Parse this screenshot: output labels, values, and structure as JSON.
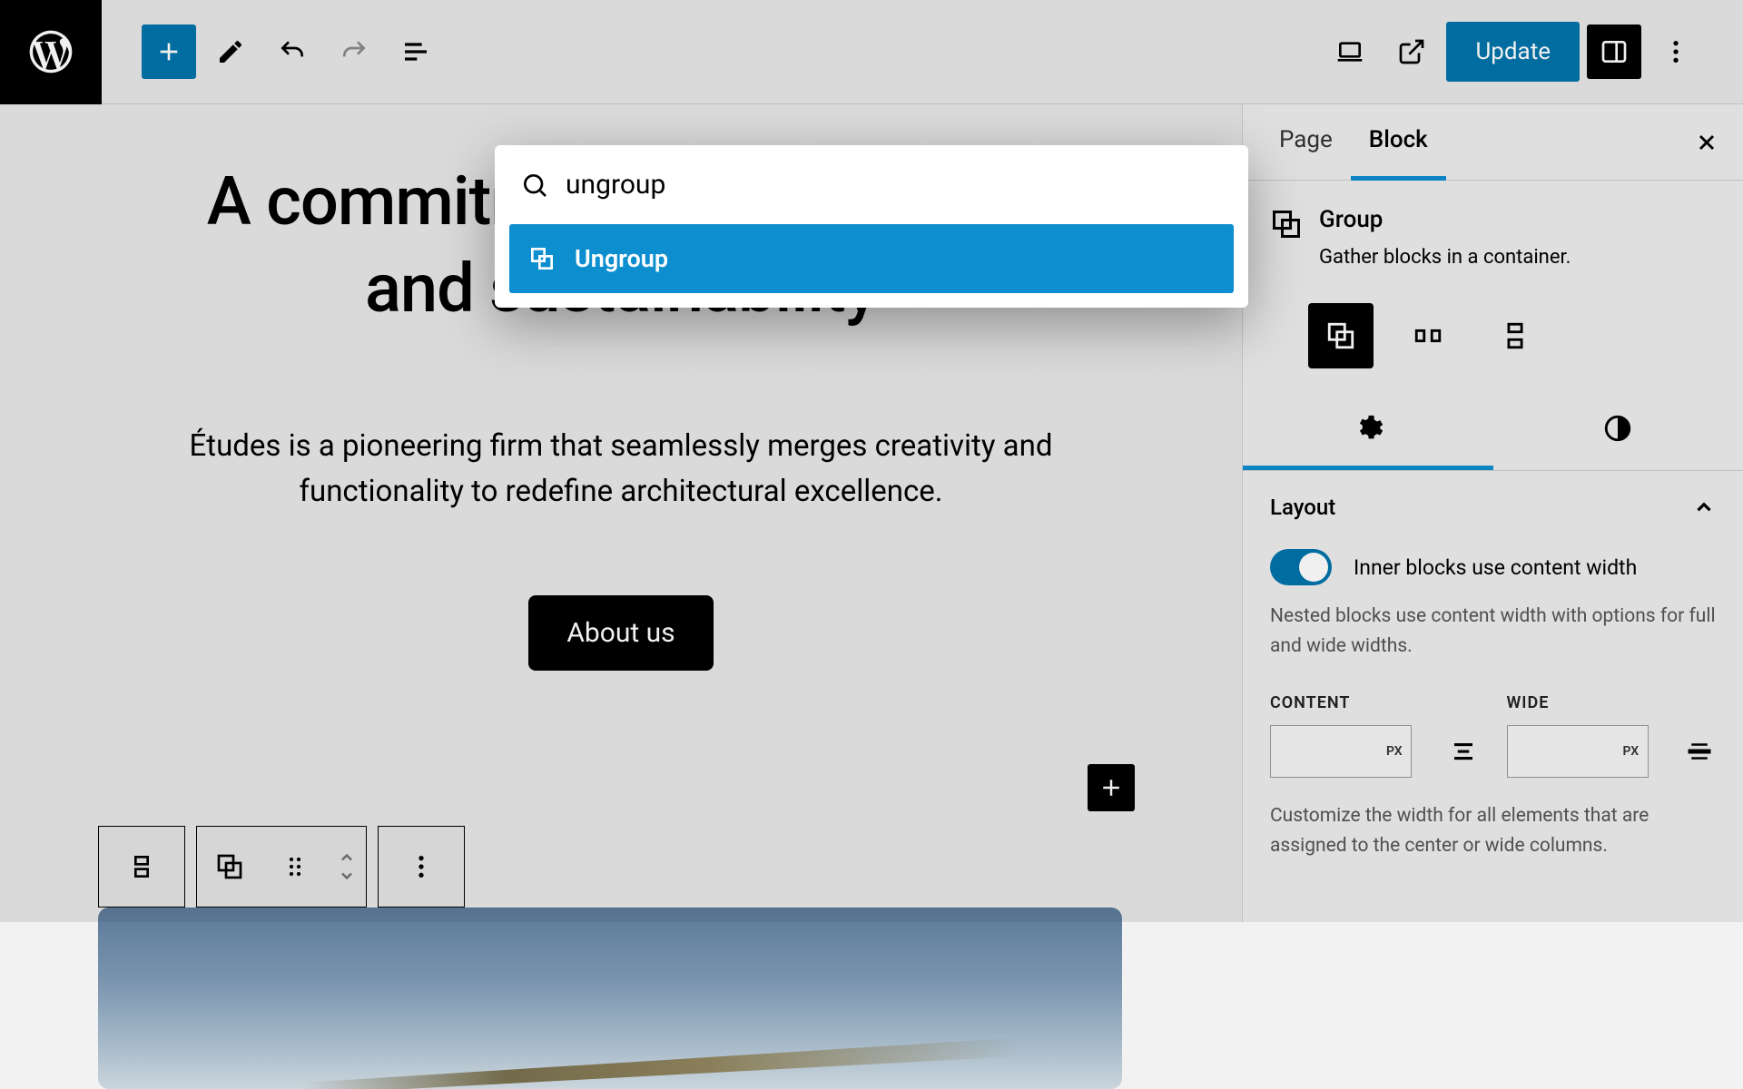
{
  "toolbar": {
    "update_label": "Update"
  },
  "canvas": {
    "heading": "A commitment to innovation and sustainability",
    "paragraph": "Études is a pioneering firm that seamlessly merges creativity and functionality to redefine architectural excellence.",
    "about_label": "About us"
  },
  "palette": {
    "search_value": "ungroup",
    "result_label": "Ungroup"
  },
  "sidebar": {
    "tabs": {
      "page": "Page",
      "block": "Block"
    },
    "block": {
      "title": "Group",
      "description": "Gather blocks in a container."
    },
    "layout": {
      "title": "Layout",
      "toggle_label": "Inner blocks use content width",
      "help1": "Nested blocks use content width with options for full and wide widths.",
      "content_label": "CONTENT",
      "wide_label": "WIDE",
      "unit": "PX",
      "help2": "Customize the width for all elements that are assigned to the center or wide columns."
    }
  }
}
